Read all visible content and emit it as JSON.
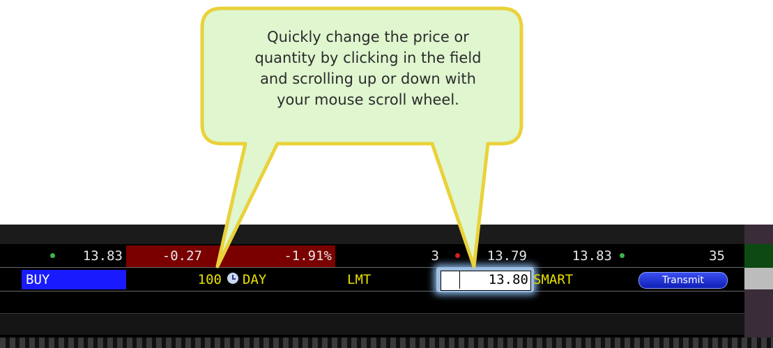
{
  "callout": {
    "lines": [
      "Quickly change the price or",
      "quantity by clicking in the field",
      "and scrolling up or down with",
      "your mouse scroll wheel."
    ]
  },
  "quote_row": {
    "bid_size_dot": "green",
    "bid": "13.83",
    "change": "-0.27",
    "change_pct": "-1.91%",
    "size": "3",
    "last": "13.79",
    "ask": "13.83",
    "volume": "35"
  },
  "order_row": {
    "action": "BUY",
    "quantity": "100",
    "quantity_icon": "clock-icon",
    "tif": "DAY",
    "order_type": "LMT",
    "price": "13.80",
    "destination": "SMART",
    "transmit_label": "Transmit"
  },
  "colors": {
    "buy_blue": "#1a1aff",
    "change_red": "#8b0000",
    "yellow_text": "#e8e000",
    "callout_fill": "#dff6cf",
    "callout_border": "#e9d23a",
    "transmit_blue": "#1c2fd6"
  }
}
